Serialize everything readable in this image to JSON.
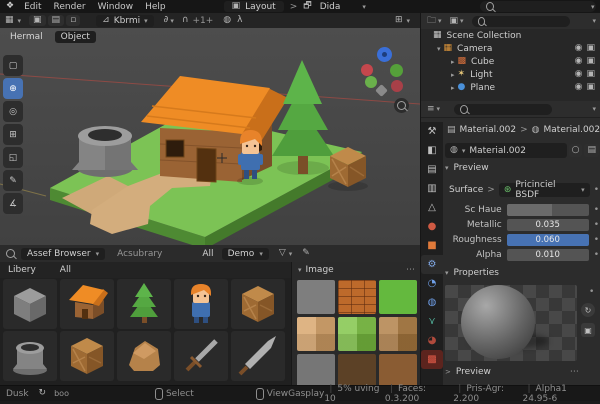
{
  "icons": {
    "chevron_down": "▾",
    "chevron_right": "▸",
    "gt": ">",
    "funnel": "▽",
    "pen": "✎",
    "magnet": "∩",
    "link": "∂",
    "refresh": "↻",
    "eye": "◉",
    "cam": "▣",
    "dot": "•",
    "dots": "⋯",
    "plus_one": "+1+",
    "sphere": "◍",
    "circle": "○",
    "editor_props": "≡",
    "grid": "▦",
    "nodes": "⊛",
    "screen": "▣",
    "shade_a": "◍",
    "shade_b": "○",
    "overlay": "⊞",
    "square": "▤",
    "collection": "▦"
  },
  "topbar": {
    "menus": [
      "Edit",
      "Render",
      "Window",
      "Help"
    ],
    "workspace": "Layout",
    "scene": "Dida"
  },
  "vheader": {
    "mode": "Kbrmi",
    "tabs": [
      "Hermal",
      "Object"
    ]
  },
  "vtools": [
    {
      "name": "select-box",
      "glyph": "▢"
    },
    {
      "name": "cursor",
      "glyph": "⊕"
    },
    {
      "name": "move",
      "glyph": "◎"
    },
    {
      "name": "rotate",
      "glyph": "⊞"
    },
    {
      "name": "scale",
      "glyph": "◱"
    },
    {
      "name": "annotate",
      "glyph": "✎"
    },
    {
      "name": "measure",
      "glyph": "∡"
    }
  ],
  "outliner": {
    "root": "Scene Collection",
    "items": [
      {
        "label": "Camera",
        "glyph": "▦",
        "color": "#e0973a"
      },
      {
        "label": "Cube",
        "glyph": "▩",
        "color": "#d8703c"
      },
      {
        "label": "Light",
        "glyph": "✶",
        "color": "#e8c87a"
      },
      {
        "label": "Plane",
        "glyph": "●",
        "color": "#4a90d9"
      }
    ]
  },
  "properties": {
    "tabs": [
      {
        "name": "tool",
        "glyph": "⚒",
        "color": "#c0c0c0"
      },
      {
        "name": "render",
        "glyph": "◧",
        "color": "#c0c0c0"
      },
      {
        "name": "output",
        "glyph": "▤",
        "color": "#c0c0c0"
      },
      {
        "name": "view-layer",
        "glyph": "▥",
        "color": "#c0c0c0"
      },
      {
        "name": "scene",
        "glyph": "△",
        "color": "#c0c0c0"
      },
      {
        "name": "world",
        "glyph": "●",
        "color": "#cf5a43"
      },
      {
        "name": "object",
        "glyph": "■",
        "color": "#e07a3a"
      },
      {
        "name": "modifiers",
        "glyph": "⚙",
        "color": "#82aae8"
      },
      {
        "name": "particles",
        "glyph": "◔",
        "color": "#6f9fe8"
      },
      {
        "name": "physics",
        "glyph": "◍",
        "color": "#6f9fe8"
      },
      {
        "name": "constraints",
        "glyph": "⋎",
        "color": "#54b8a0"
      },
      {
        "name": "data",
        "glyph": "◕",
        "color": "#b04a3c"
      },
      {
        "name": "material",
        "glyph": "▩",
        "color": "#e05a48"
      }
    ],
    "breadcrumb": [
      "Material.002",
      "Material.002"
    ],
    "name_field": "Material.002",
    "preview_label": "Preview",
    "surface_label": "Surface",
    "surface_value": "Pricinciel BSDF",
    "sliders": [
      {
        "label": "Sc Haue",
        "value": ""
      },
      {
        "label": "Metallic",
        "value": "0.035"
      },
      {
        "label": "Roughness",
        "value": "0.060"
      },
      {
        "label": "Alpha",
        "value": "0.010"
      }
    ],
    "properties_label": "Properties",
    "preview2_label": "Preview"
  },
  "assets": {
    "editor": "Assef Browser",
    "library": "Acsubrary",
    "filter_all": "All",
    "filter_demo": "Demo",
    "tab_library": "Libery",
    "tab_all": "All",
    "image_title": "Image",
    "items": [
      "cube",
      "house",
      "tree",
      "character",
      "crate",
      "well",
      "crate",
      "rock",
      "sword",
      "sword"
    ],
    "swatches": [
      "#7e7e7e",
      "#bd6a2b",
      "#64b93e",
      "#d7a367",
      "#7cc242",
      "#ad7b41",
      "#767676",
      "#5c4126",
      "#8a5c33"
    ]
  },
  "statusbar": {
    "mode": "Dusk",
    "extra": "boo",
    "select": "Select",
    "view": "View",
    "stats": [
      "Gasplay",
      "5% uving 10",
      "Faces: 0.3.200",
      "Pris-Agr: 2.200",
      "Alpha1 24.95-6"
    ]
  },
  "colors": {
    "accent": "#4772b3",
    "grass": "#7cc355",
    "roof": "#ef8c25"
  }
}
